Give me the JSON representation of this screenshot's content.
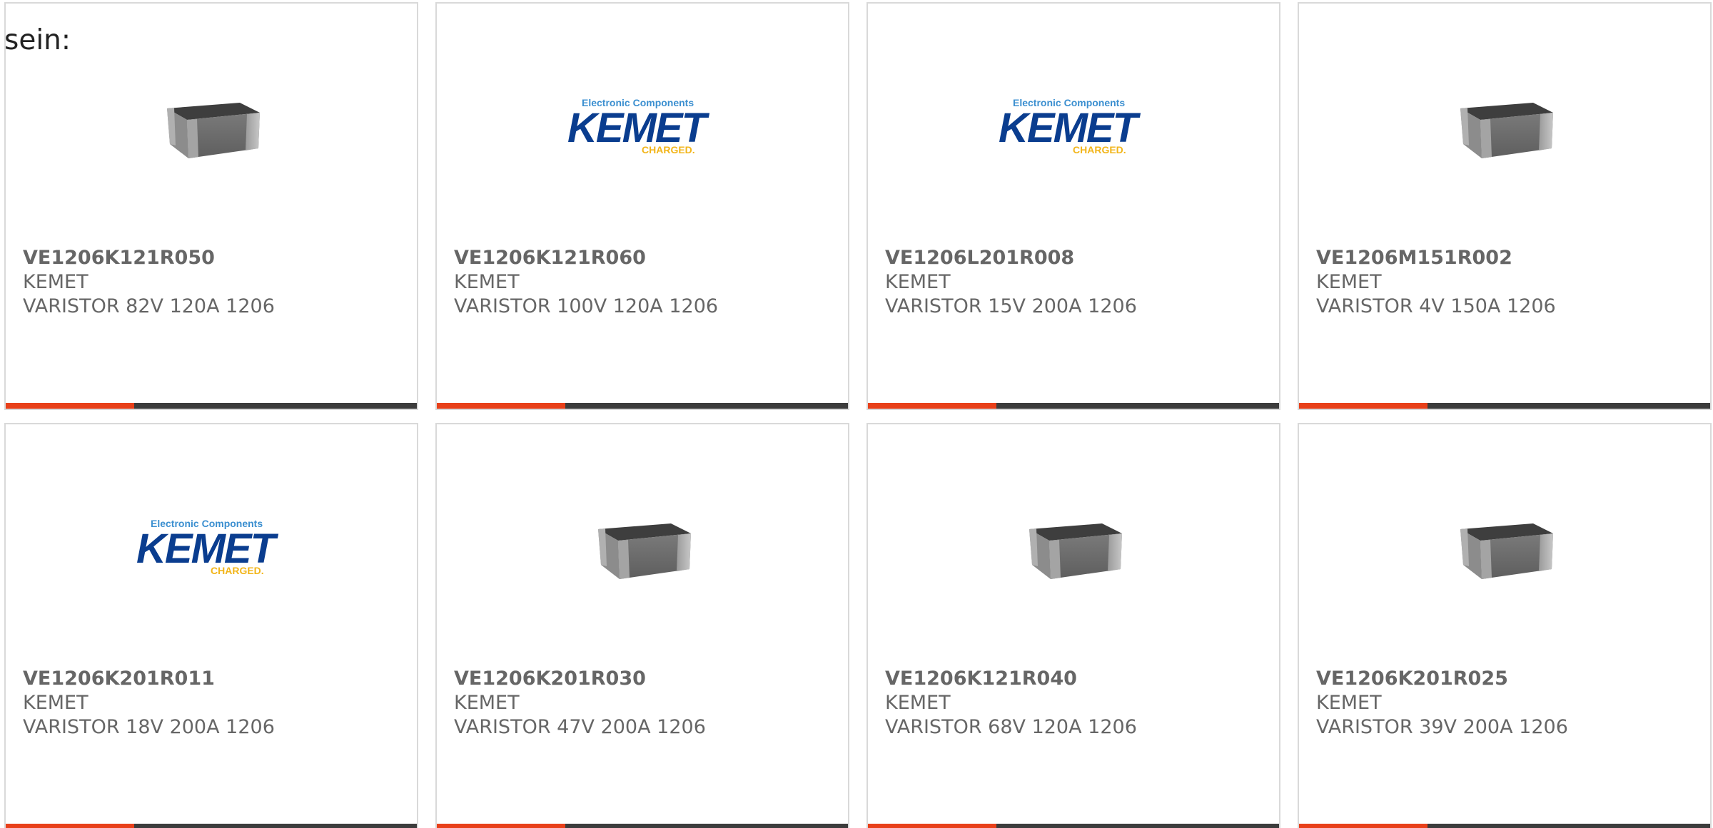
{
  "intro_text": "sein:",
  "logo": {
    "tagline": "Electronic Components",
    "word": "KEMET",
    "charged": "CHARGED."
  },
  "colors": {
    "accent": "#e8401a",
    "bar": "#3c3c3c",
    "border": "#d9d9d9",
    "text": "#666666",
    "logo_blue": "#0a3d8f",
    "logo_light_blue": "#3b8fd0",
    "logo_yellow": "#f2b51a"
  },
  "products": [
    {
      "part_number": "VE1206K121R050",
      "manufacturer": "KEMET",
      "description": "VARISTOR 82V 120A 1206",
      "image": "chip-component-icon"
    },
    {
      "part_number": "VE1206K121R060",
      "manufacturer": "KEMET",
      "description": "VARISTOR 100V 120A 1206",
      "image": "kemet-logo"
    },
    {
      "part_number": "VE1206L201R008",
      "manufacturer": "KEMET",
      "description": "VARISTOR 15V 200A 1206",
      "image": "kemet-logo"
    },
    {
      "part_number": "VE1206M151R002",
      "manufacturer": "KEMET",
      "description": "VARISTOR 4V 150A 1206",
      "image": "chip-component-icon"
    },
    {
      "part_number": "VE1206K201R011",
      "manufacturer": "KEMET",
      "description": "VARISTOR 18V 200A 1206",
      "image": "kemet-logo"
    },
    {
      "part_number": "VE1206K201R030",
      "manufacturer": "KEMET",
      "description": "VARISTOR 47V 200A 1206",
      "image": "chip-component-icon"
    },
    {
      "part_number": "VE1206K121R040",
      "manufacturer": "KEMET",
      "description": "VARISTOR 68V 120A 1206",
      "image": "chip-component-icon"
    },
    {
      "part_number": "VE1206K201R025",
      "manufacturer": "KEMET",
      "description": "VARISTOR 39V 200A 1206",
      "image": "chip-component-icon"
    }
  ]
}
